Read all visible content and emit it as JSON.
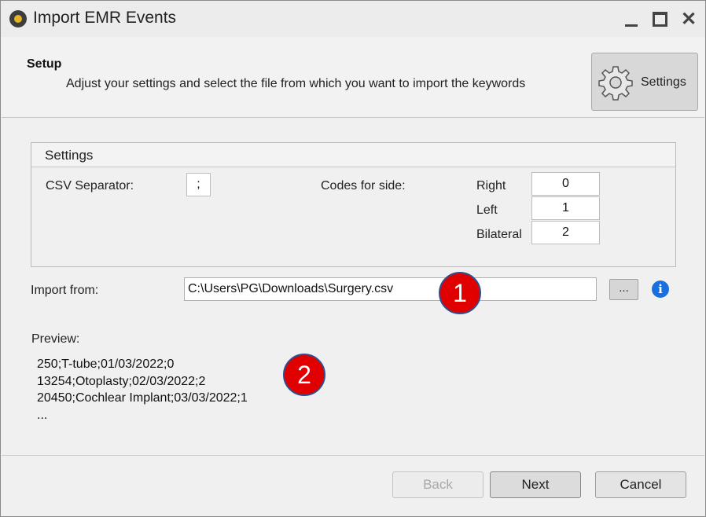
{
  "window": {
    "title": "Import EMR Events"
  },
  "header": {
    "title": "Setup",
    "description": "Adjust your settings and select the file from which you want to import the keywords",
    "settings_button": "Settings"
  },
  "settings": {
    "group_title": "Settings",
    "csv_separator_label": "CSV Separator:",
    "csv_separator_value": ";",
    "codes_for_side_label": "Codes for side:",
    "sides": [
      {
        "label": "Right",
        "value": "0"
      },
      {
        "label": "Left",
        "value": "1"
      },
      {
        "label": "Bilateral",
        "value": "2"
      }
    ]
  },
  "import": {
    "label": "Import from:",
    "path": "C:\\Users\\PG\\Downloads\\Surgery.csv",
    "browse_label": "...",
    "info_glyph": "i"
  },
  "preview": {
    "label": "Preview:",
    "lines": [
      "250;T-tube;01/03/2022;0",
      "13254;Otoplasty;02/03/2022;2",
      "20450;Cochlear Implant;03/03/2022;1",
      "..."
    ]
  },
  "callouts": [
    "1",
    "2"
  ],
  "footer": {
    "back": "Back",
    "next": "Next",
    "cancel": "Cancel"
  },
  "colors": {
    "callout": "#e00000",
    "info": "#1a6fe0"
  }
}
